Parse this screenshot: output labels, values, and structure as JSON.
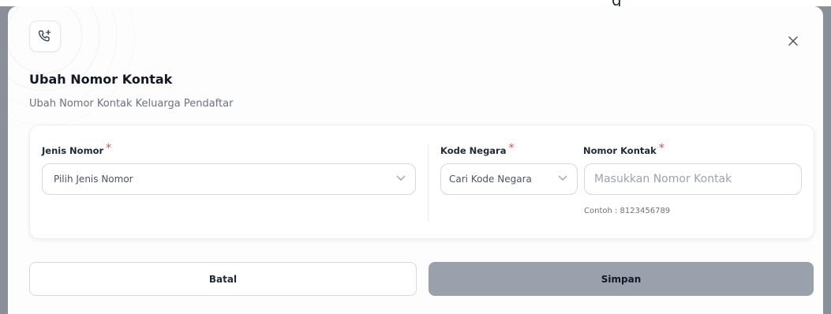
{
  "modal": {
    "title": "Ubah Nomor Kontak",
    "subtitle": "Ubah Nomor Kontak Keluarga Pendaftar",
    "icons": {
      "header": "phone-plus-icon",
      "close": "close-icon",
      "dropdown": "chevron-down-icon"
    }
  },
  "form": {
    "jenis_nomor": {
      "label": "Jenis Nomor",
      "required": "*",
      "placeholder": "Pilih Jenis Nomor"
    },
    "kode_negara": {
      "label": "Kode Negara",
      "required": "*",
      "placeholder": "Cari Kode Negara"
    },
    "nomor_kontak": {
      "label": "Nomor Kontak",
      "required": "*",
      "placeholder": "Masukkan Nomor Kontak",
      "hint": "Contoh : 8123456789"
    }
  },
  "actions": {
    "cancel": "Batal",
    "save": "Simpan"
  },
  "colors": {
    "required": "#e5484d",
    "save_bg": "#9aa1ad",
    "overlay": "#8a8f99"
  }
}
